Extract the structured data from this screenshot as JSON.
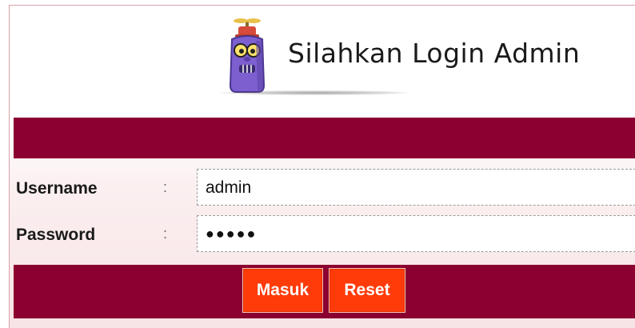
{
  "header": {
    "title": "Silahkan Login Admin",
    "mascot_icon": "robot-mascot-icon"
  },
  "form": {
    "username": {
      "label": "Username",
      "colon": ":",
      "value": "admin"
    },
    "password": {
      "label": "Password",
      "colon": ":",
      "value": "●●●●●"
    },
    "buttons": {
      "submit_label": "Masuk",
      "reset_label": "Reset"
    }
  },
  "colors": {
    "bar": "#8b0030",
    "button": "#ff3b0a",
    "mascot_body": "#7d5fd0"
  }
}
